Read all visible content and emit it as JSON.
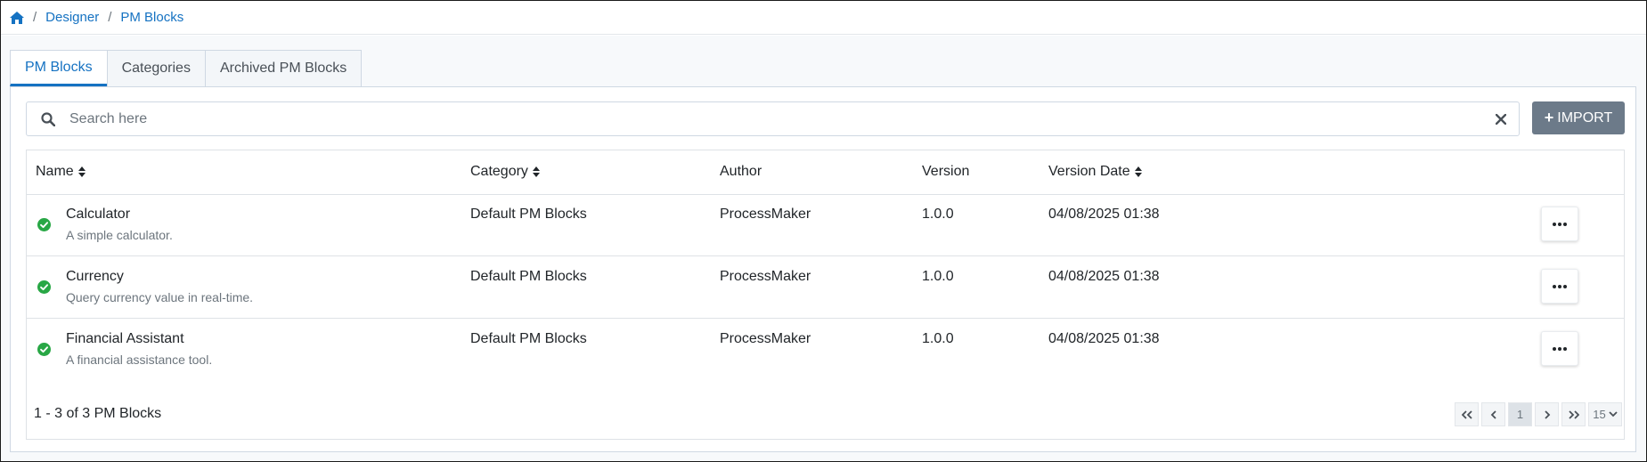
{
  "breadcrumb": {
    "home_icon": "home-icon",
    "items": [
      {
        "label": "Designer"
      },
      {
        "label": "PM Blocks"
      }
    ]
  },
  "tabs": [
    {
      "label": "PM Blocks",
      "active": true
    },
    {
      "label": "Categories",
      "active": false
    },
    {
      "label": "Archived PM Blocks",
      "active": false
    }
  ],
  "search": {
    "placeholder": "Search here",
    "value": ""
  },
  "import_button": {
    "label": "IMPORT"
  },
  "table": {
    "columns": [
      {
        "label": "Name",
        "sortable": true
      },
      {
        "label": "Category",
        "sortable": true
      },
      {
        "label": "Author",
        "sortable": false
      },
      {
        "label": "Version",
        "sortable": false
      },
      {
        "label": "Version Date",
        "sortable": true
      }
    ],
    "rows": [
      {
        "name": "Calculator",
        "description": "A simple calculator.",
        "category": "Default PM Blocks",
        "author": "ProcessMaker",
        "version": "1.0.0",
        "version_date": "04/08/2025 01:38"
      },
      {
        "name": "Currency",
        "description": "Query currency value in real-time.",
        "category": "Default PM Blocks",
        "author": "ProcessMaker",
        "version": "1.0.0",
        "version_date": "04/08/2025 01:38"
      },
      {
        "name": "Financial Assistant",
        "description": "A financial assistance tool.",
        "category": "Default PM Blocks",
        "author": "ProcessMaker",
        "version": "1.0.0",
        "version_date": "04/08/2025 01:38"
      }
    ]
  },
  "footer": {
    "count_text": "1 - 3 of 3 PM Blocks",
    "current_page": "1",
    "per_page": "15"
  },
  "colors": {
    "link": "#1572c2",
    "status_ok": "#28a745",
    "import_bg": "#6c7a89"
  }
}
